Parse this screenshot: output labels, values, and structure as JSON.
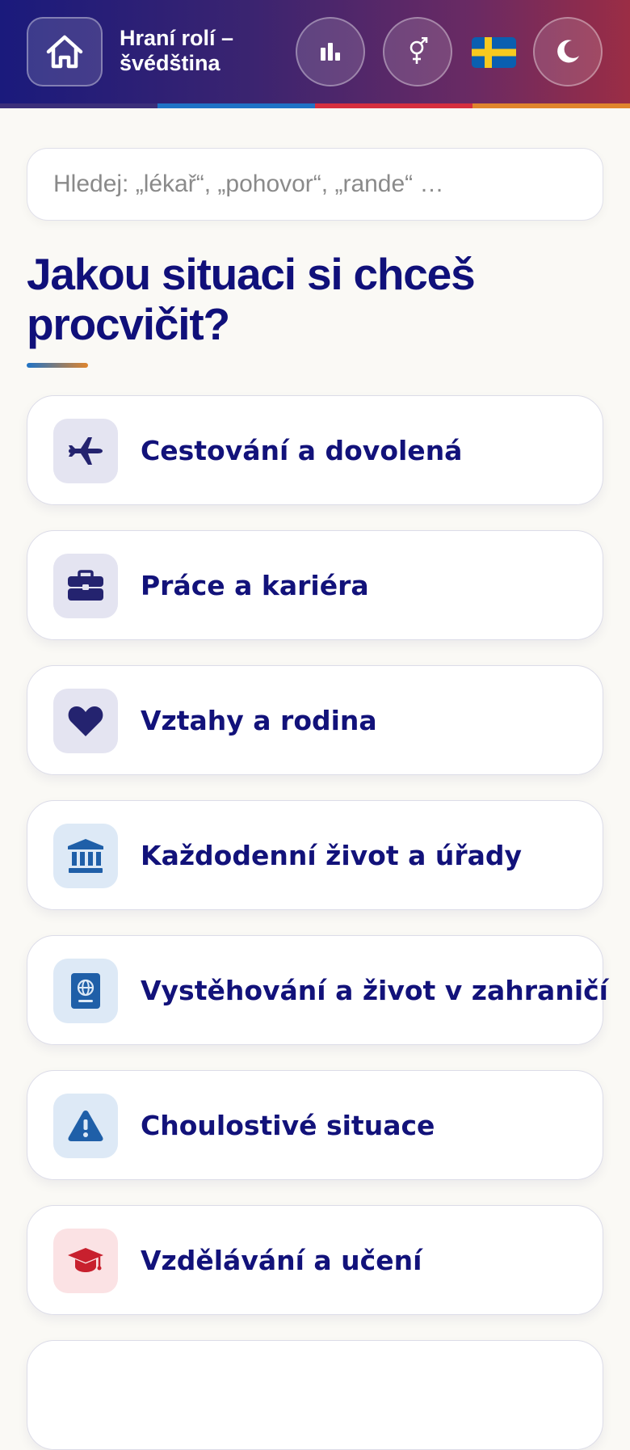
{
  "header": {
    "title": "Hraní rolí – švédština",
    "home_icon": "home-icon",
    "stats_icon": "bar-chart-icon",
    "gender_icon": "gender-icon",
    "flag": "sweden-flag-icon",
    "theme_icon": "moon-icon",
    "stripe_colors": [
      "#3b2f7a",
      "#1f73c6",
      "#d62f3f",
      "#e0852d"
    ]
  },
  "search": {
    "placeholder": "Hledej: „lékař“, „pohovor“, „rande“ …",
    "value": ""
  },
  "main": {
    "heading": "Jakou situaci si chceš procvičit?"
  },
  "categories": [
    {
      "label": "Cestování a dovolená",
      "icon": "airplane-icon",
      "icon_bg": "#e4e4f1",
      "icon_color": "#24236f"
    },
    {
      "label": "Práce a kariéra",
      "icon": "briefcase-icon",
      "icon_bg": "#e4e4f1",
      "icon_color": "#24236f"
    },
    {
      "label": "Vztahy a rodina",
      "icon": "heart-icon",
      "icon_bg": "#e4e4f1",
      "icon_color": "#24236f"
    },
    {
      "label": "Každodenní život a úřady",
      "icon": "bank-icon",
      "icon_bg": "#dde9f6",
      "icon_color": "#1f5fa8"
    },
    {
      "label": "Vystěhování a život v zahraničí",
      "icon": "passport-icon",
      "icon_bg": "#dde9f6",
      "icon_color": "#1f5fa8"
    },
    {
      "label": "Choulostivé situace",
      "icon": "warning-icon",
      "icon_bg": "#dde9f6",
      "icon_color": "#1f5fa8"
    },
    {
      "label": "Vzdělávání a učení",
      "icon": "graduation-cap-icon",
      "icon_bg": "#fbe2e4",
      "icon_color": "#c8202e"
    },
    {
      "label": "",
      "icon": "",
      "icon_bg": "#ffffff",
      "icon_color": "#ffffff"
    }
  ],
  "colors": {
    "accent": "#12127a",
    "background": "#faf9f5",
    "card_border": "#dcdce8"
  }
}
